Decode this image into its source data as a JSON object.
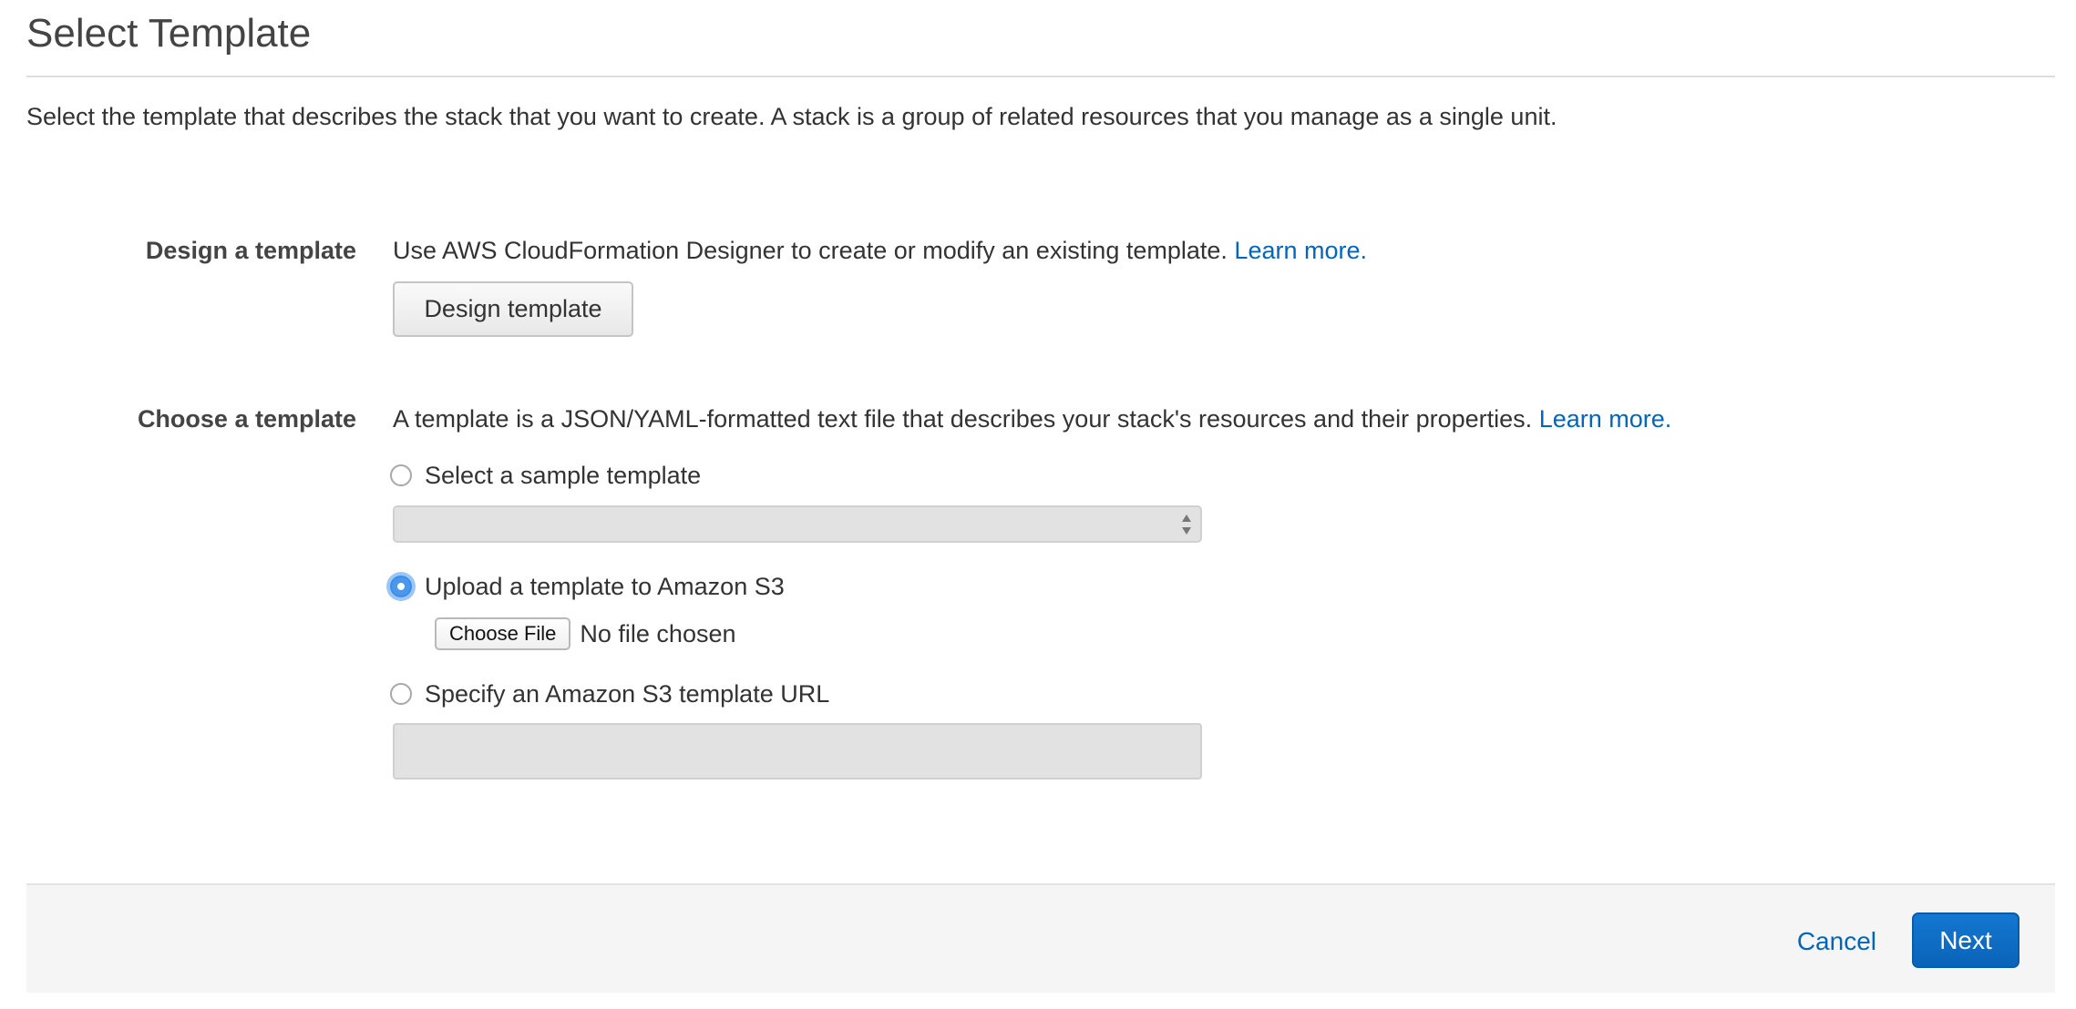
{
  "header": {
    "title": "Select Template",
    "description": "Select the template that describes the stack that you want to create. A stack is a group of related resources that you manage as a single unit."
  },
  "design_section": {
    "label": "Design a template",
    "description": "Use AWS CloudFormation Designer to create or modify an existing template.",
    "learn_more": "Learn more.",
    "button_label": "Design template"
  },
  "choose_section": {
    "label": "Choose a template",
    "description": "A template is a JSON/YAML-formatted text file that describes your stack's resources and their properties.",
    "learn_more": "Learn more.",
    "options": [
      {
        "label": "Select a sample template",
        "checked": false
      },
      {
        "label": "Upload a template to Amazon S3",
        "checked": true
      },
      {
        "label": "Specify an Amazon S3 template URL",
        "checked": false
      }
    ],
    "sample_select_value": "",
    "file_button_label": "Choose File",
    "file_status": "No file chosen",
    "url_value": ""
  },
  "footer": {
    "cancel_label": "Cancel",
    "next_label": "Next"
  },
  "colors": {
    "link": "#0066bb",
    "primary_button": "#0a64b8",
    "radio_selected": "#4a97ec"
  }
}
